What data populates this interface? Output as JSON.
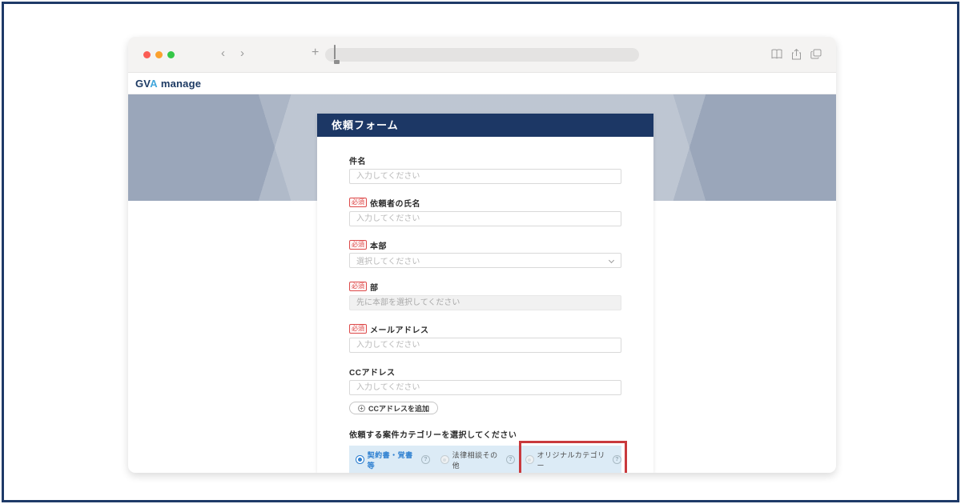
{
  "browser": {
    "traffic_colors": [
      "#fb5d55",
      "#fba12e",
      "#35c748"
    ],
    "nav": {
      "back": "‹",
      "forward": "›",
      "new_tab": "+"
    }
  },
  "logo": {
    "gv": "GV",
    "a": "A",
    "rest": "manage"
  },
  "form": {
    "title": "依頼フォーム",
    "required_badge": "必須",
    "fields": [
      {
        "label": "件名",
        "required": false,
        "type": "text",
        "placeholder": "入力してください"
      },
      {
        "label": "依頼者の氏名",
        "required": true,
        "type": "text",
        "placeholder": "入力してください"
      },
      {
        "label": "本部",
        "required": true,
        "type": "select",
        "placeholder": "選択してください"
      },
      {
        "label": "部",
        "required": true,
        "type": "text-disabled",
        "placeholder": "先に本部を選択してください"
      },
      {
        "label": "メールアドレス",
        "required": true,
        "type": "text",
        "placeholder": "入力してください"
      },
      {
        "label": "CCアドレス",
        "required": false,
        "type": "text",
        "placeholder": "入力してください"
      }
    ],
    "add_cc_button": "CCアドレスを追加",
    "category": {
      "label": "依頼する案件カテゴリーを選択してください",
      "help_glyph": "?",
      "options": [
        {
          "label": "契約書・覚書等",
          "selected": true,
          "highlighted": false
        },
        {
          "label": "法律相談その他",
          "selected": false,
          "highlighted": false
        },
        {
          "label": "オリジナルカテゴリー",
          "selected": false,
          "highlighted": true
        }
      ]
    }
  },
  "colors": {
    "frame_border": "#1e3a68",
    "card_header": "#1c3765",
    "banner_base": "#9aa6ba",
    "band_blue": "#dcebf6",
    "accent_blue": "#2d7fd0",
    "logo_light_blue": "#41a6db",
    "required_red": "#dd4b4b",
    "highlight_red": "#c9393d"
  }
}
